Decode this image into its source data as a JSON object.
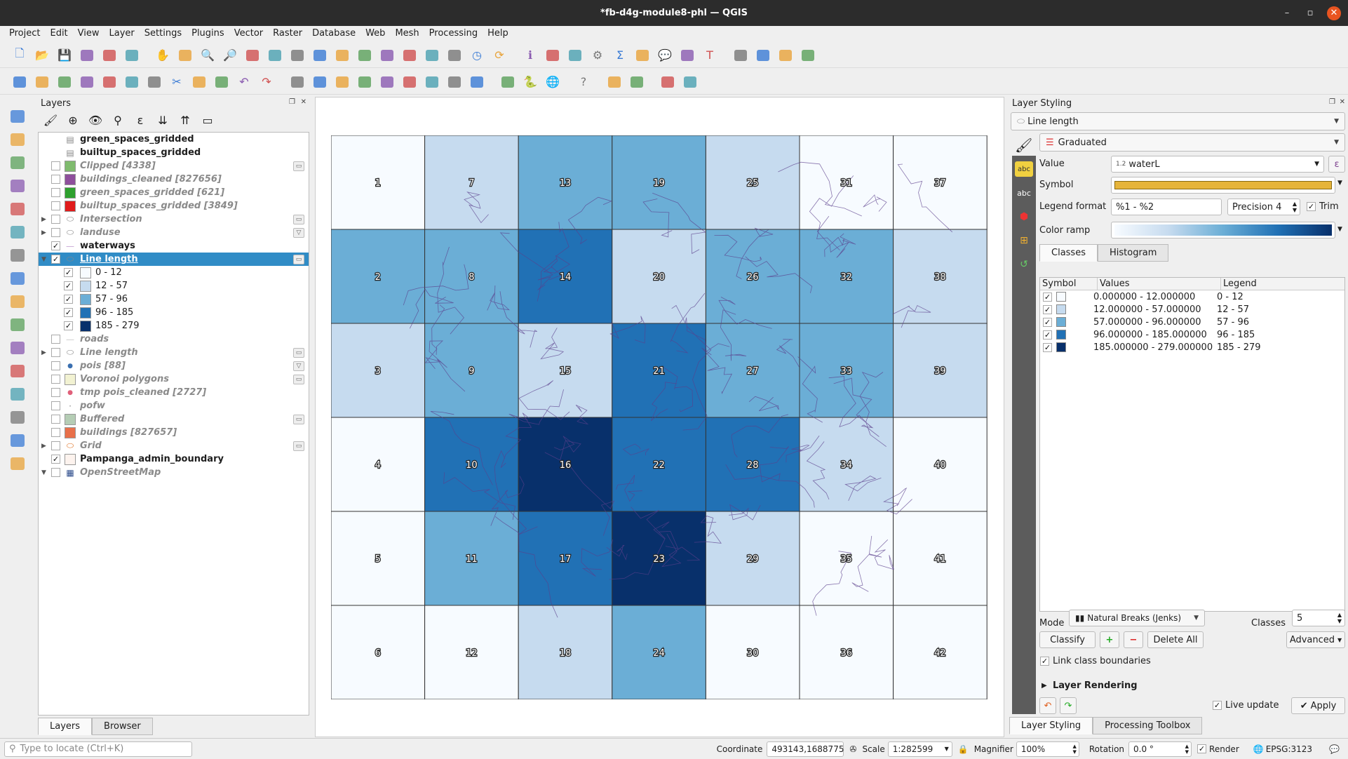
{
  "window": {
    "title": "*fb-d4g-module8-phl — QGIS",
    "minimize": "–",
    "maximize": "▫",
    "close": "✕"
  },
  "menu": [
    "Project",
    "Edit",
    "View",
    "Layer",
    "Settings",
    "Plugins",
    "Vector",
    "Raster",
    "Database",
    "Web",
    "Mesh",
    "Processing",
    "Help"
  ],
  "toolbar1": [
    "new-project",
    "open-project",
    "save-project",
    "save-as",
    "print-layout",
    "style-manager",
    "|",
    "pan",
    "pan-to-selection",
    "zoom-in",
    "zoom-out",
    "zoom-full",
    "zoom-selection",
    "zoom-layer",
    "zoom-native",
    "zoom-last",
    "zoom-next",
    "new-map-view",
    "new-3d-view",
    "new-bookmark",
    "show-bookmarks",
    "temporal",
    "refresh",
    "|",
    "identify",
    "attribute-table",
    "field-calculator",
    "processing-toolbox",
    "statistics",
    "measure",
    "map-tips",
    "annotation",
    "text-annotation",
    "|",
    "select-features",
    "select-by-value",
    "deselect",
    "select-location"
  ],
  "toolbar2": [
    "digitize",
    "toggle-editing",
    "save-edits",
    "add-feature",
    "vertex-tool",
    "modify-attributes",
    "delete-selected",
    "cut",
    "copy",
    "paste",
    "undo",
    "redo",
    "|",
    "label-tool",
    "diagram",
    "label-pin",
    "label-show",
    "label-move",
    "label-rotate",
    "label-change",
    "label-highlight",
    "label-abc",
    "|",
    "georeferencer",
    "python-console",
    "globe",
    "|",
    "help",
    "|",
    "plugin-a",
    "plugin-b",
    "|",
    "quickosm",
    "plugin-c"
  ],
  "toolbar_glyphs": {
    "new-project": "🗋",
    "open-project": "📂",
    "save-project": "💾",
    "pan": "✋",
    "zoom-in": "🔍",
    "zoom-out": "🔎",
    "refresh": "⟳",
    "identify": "ℹ",
    "statistics": "Σ",
    "processing-toolbox": "⚙",
    "temporal": "◷",
    "help": "?",
    "python-console": "🐍",
    "globe": "🌐",
    "undo": "↶",
    "redo": "↷",
    "cut": "✂",
    "map-tips": "💬",
    "text-annotation": "T"
  },
  "left_tools": [
    "add-vector",
    "add-raster",
    "add-delimited",
    "add-spatialite",
    "add-postgis",
    "add-virtual",
    "new-shapefile",
    "new-geopackage",
    "new-temp",
    "new-spatialite",
    "new-virtual",
    "add-wms",
    "add-wfs",
    "add-wcs",
    "add-xyz",
    "add-mesh"
  ],
  "layers_panel": {
    "title": "Layers",
    "items": [
      {
        "name": "green_spaces_gridded",
        "kind": "table",
        "visible": null,
        "style": "on"
      },
      {
        "name": "builtup_spaces_gridded",
        "kind": "table",
        "visible": null,
        "style": "on"
      },
      {
        "name": "Clipped [4338]",
        "kind": "fill",
        "color": "#7fbb6e",
        "visible": false,
        "style": "off",
        "indicator": "memory"
      },
      {
        "name": "buildings_cleaned [827656]",
        "kind": "fill",
        "color": "#8e4f9c",
        "visible": false,
        "style": "off"
      },
      {
        "name": "green_spaces_gridded [621]",
        "kind": "fill",
        "color": "#2ea02e",
        "visible": false,
        "style": "off"
      },
      {
        "name": "builtup_spaces_gridded [3849]",
        "kind": "fill",
        "color": "#e01b1b",
        "visible": false,
        "style": "off"
      },
      {
        "name": "Intersection",
        "kind": "polygon-group",
        "visible": false,
        "style": "off",
        "expand": "collapsed",
        "indicator": "memory"
      },
      {
        "name": "landuse",
        "kind": "polygon-group",
        "visible": false,
        "style": "off",
        "expand": "collapsed",
        "indicator": "filter"
      },
      {
        "name": "waterways",
        "kind": "line",
        "color": "#c9a6d6",
        "visible": true,
        "style": "on"
      },
      {
        "name": "Line length",
        "kind": "polygon-group",
        "visible": true,
        "style": "selected",
        "expand": "expanded",
        "indicator": "memory"
      },
      {
        "name": "0 - 12",
        "kind": "class",
        "color": "#f7fbff",
        "visible": true
      },
      {
        "name": "12 - 57",
        "kind": "class",
        "color": "#c6dbef",
        "visible": true
      },
      {
        "name": "57 - 96",
        "kind": "class",
        "color": "#6baed6",
        "visible": true
      },
      {
        "name": "96 - 185",
        "kind": "class",
        "color": "#2171b5",
        "visible": true
      },
      {
        "name": "185 - 279",
        "kind": "class",
        "color": "#08306b",
        "visible": true
      },
      {
        "name": "roads",
        "kind": "line",
        "color": "#cccccc",
        "visible": false,
        "style": "off"
      },
      {
        "name": "Line length",
        "kind": "polygon-group",
        "visible": false,
        "style": "off",
        "expand": "collapsed",
        "indicator": "memory"
      },
      {
        "name": "pois [88]",
        "kind": "point",
        "color": "#3a6fb0",
        "visible": false,
        "style": "off",
        "indicator": "filter"
      },
      {
        "name": "Voronoi polygons",
        "kind": "fill",
        "color": "#f2f2d2",
        "visible": false,
        "style": "off",
        "indicator": "memory"
      },
      {
        "name": "tmp pois_cleaned [2727]",
        "kind": "point",
        "color": "#e0607a",
        "visible": false,
        "style": "off"
      },
      {
        "name": "pofw",
        "kind": "dot",
        "color": "#888888",
        "visible": false,
        "style": "off"
      },
      {
        "name": "Buffered",
        "kind": "fill",
        "color": "#b5cdb5",
        "visible": false,
        "style": "off",
        "indicator": "memory"
      },
      {
        "name": "buildings [827657]",
        "kind": "fill",
        "color": "#e8704a",
        "visible": false,
        "style": "off"
      },
      {
        "name": "Grid",
        "kind": "grid-group",
        "visible": false,
        "style": "off",
        "expand": "collapsed",
        "indicator": "memory"
      },
      {
        "name": "Pampanga_admin_boundary",
        "kind": "fill",
        "color": "#fdf3ee",
        "visible": true,
        "style": "on"
      },
      {
        "name": "OpenStreetMap",
        "kind": "raster",
        "visible": false,
        "style": "off",
        "expand": "expanded"
      }
    ],
    "tabs": [
      "Layers",
      "Browser"
    ]
  },
  "map": {
    "class_colors": [
      "#f7fbff",
      "#c6dbef",
      "#6baed6",
      "#2171b5",
      "#08306b"
    ],
    "waterway_color": "#5b3f8c",
    "columns": 7,
    "rows": 6,
    "cells": [
      {
        "id": "1",
        "class": 0
      },
      {
        "id": "2",
        "class": 2
      },
      {
        "id": "3",
        "class": 1
      },
      {
        "id": "4",
        "class": 0
      },
      {
        "id": "5",
        "class": 0
      },
      {
        "id": "6",
        "class": 0
      },
      {
        "id": "7",
        "class": 1
      },
      {
        "id": "8",
        "class": 2
      },
      {
        "id": "9",
        "class": 2
      },
      {
        "id": "10",
        "class": 3
      },
      {
        "id": "11",
        "class": 2
      },
      {
        "id": "12",
        "class": 0
      },
      {
        "id": "13",
        "class": 2
      },
      {
        "id": "14",
        "class": 3
      },
      {
        "id": "15",
        "class": 1
      },
      {
        "id": "16",
        "class": 4
      },
      {
        "id": "17",
        "class": 3
      },
      {
        "id": "18",
        "class": 1
      },
      {
        "id": "19",
        "class": 2
      },
      {
        "id": "20",
        "class": 1
      },
      {
        "id": "21",
        "class": 3
      },
      {
        "id": "22",
        "class": 3
      },
      {
        "id": "23",
        "class": 4
      },
      {
        "id": "24",
        "class": 2
      },
      {
        "id": "25",
        "class": 1
      },
      {
        "id": "26",
        "class": 2
      },
      {
        "id": "27",
        "class": 2
      },
      {
        "id": "28",
        "class": 3
      },
      {
        "id": "29",
        "class": 1
      },
      {
        "id": "30",
        "class": 0
      },
      {
        "id": "31",
        "class": 0
      },
      {
        "id": "32",
        "class": 2
      },
      {
        "id": "33",
        "class": 2
      },
      {
        "id": "34",
        "class": 1
      },
      {
        "id": "35",
        "class": 0
      },
      {
        "id": "36",
        "class": 0
      },
      {
        "id": "37",
        "class": 0
      },
      {
        "id": "38",
        "class": 1
      },
      {
        "id": "39",
        "class": 1
      },
      {
        "id": "40",
        "class": 0
      },
      {
        "id": "41",
        "class": 0
      },
      {
        "id": "42",
        "class": 0
      }
    ]
  },
  "styling": {
    "title": "Layer Styling",
    "layer": "Line length",
    "renderer": "Graduated",
    "value_label": "Value",
    "value_type": "1.2",
    "value": "waterL",
    "expr_glyph": "ε",
    "symbol_label": "Symbol",
    "symbol_color": "#e6b43a",
    "legend_format_label": "Legend format",
    "legend_format": "%1 - %2",
    "precision": "Precision 4",
    "trim_label": "Trim",
    "trim": true,
    "color_ramp_label": "Color ramp",
    "tabs": [
      "Classes",
      "Histogram"
    ],
    "columns": [
      "Symbol",
      "Values",
      "Legend"
    ],
    "classes": [
      {
        "values": "0.000000 - 12.000000",
        "legend": "0 - 12",
        "color": "#f7fbff"
      },
      {
        "values": "12.000000 - 57.000000",
        "legend": "12 - 57",
        "color": "#c6dbef"
      },
      {
        "values": "57.000000 - 96.000000",
        "legend": "57 - 96",
        "color": "#6baed6"
      },
      {
        "values": "96.000000 - 185.000000",
        "legend": "96 - 185",
        "color": "#2171b5"
      },
      {
        "values": "185.000000 - 279.000000",
        "legend": "185 - 279",
        "color": "#08306b"
      }
    ],
    "mode_label": "Mode",
    "mode": "Natural Breaks (Jenks)",
    "classes_label": "Classes",
    "classes_count": "5",
    "classify": "Classify",
    "add_glyph": "+",
    "remove_glyph": "−",
    "delete_all": "Delete All",
    "advanced": "Advanced",
    "link_label": "Link class boundaries",
    "layer_rendering": "Layer Rendering",
    "live_update": "Live update",
    "apply": "Apply",
    "bottom_tabs": [
      "Layer Styling",
      "Processing Toolbox"
    ]
  },
  "status": {
    "locate_placeholder": "Type to locate (Ctrl+K)",
    "coordinate_label": "Coordinate",
    "coordinate": "493143,1688775",
    "scale_label": "Scale",
    "scale": "1:282599",
    "magnifier_label": "Magnifier",
    "magnifier": "100%",
    "rotation_label": "Rotation",
    "rotation": "0.0 °",
    "render_label": "Render",
    "crs": "EPSG:3123"
  }
}
